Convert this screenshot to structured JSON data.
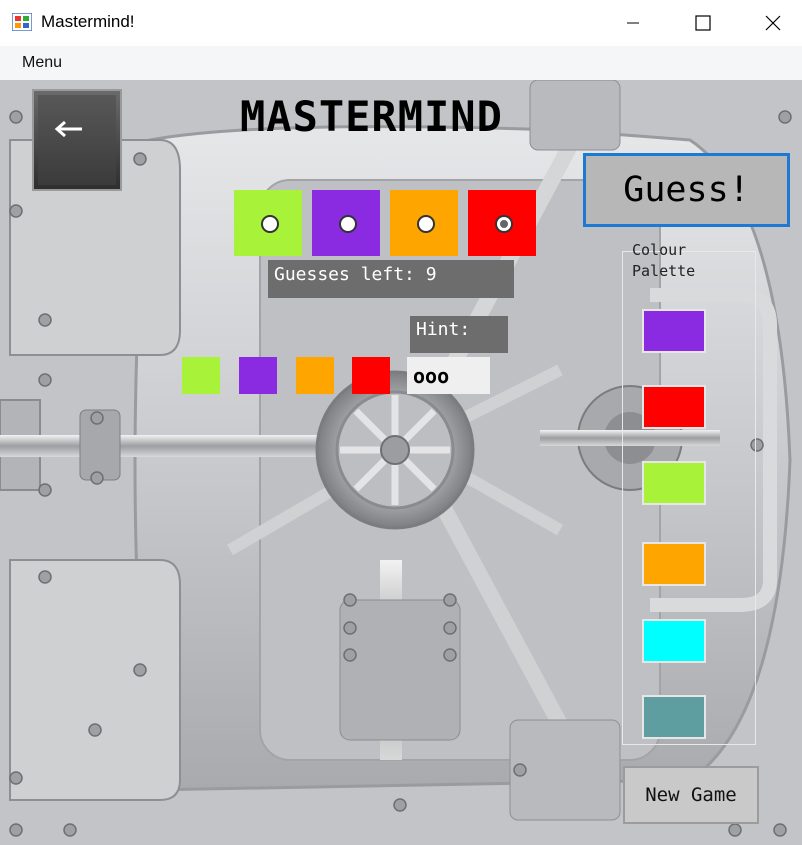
{
  "window": {
    "title": "Mastermind!"
  },
  "menu": {
    "items": [
      "Menu"
    ]
  },
  "game": {
    "title": "MASTERMIND",
    "guess_button": "Guess!",
    "current_guess": [
      {
        "color": "#a8f23a",
        "selected": false
      },
      {
        "color": "#8a2be2",
        "selected": false
      },
      {
        "color": "#ffa500",
        "selected": false
      },
      {
        "color": "#ff0000",
        "selected": true
      }
    ],
    "guesses_left": "Guesses left: 9",
    "hint_label": "Hint:",
    "hint_value": "ooo",
    "previous_guess": [
      "#a8f23a",
      "#8a2be2",
      "#ffa500",
      "#ff0000"
    ],
    "palette_title": "Colour Palette",
    "palette": [
      "#8a2be2",
      "#ff0000",
      "#a8f23a",
      "#ffa500",
      "#00ffff",
      "#5f9ea0"
    ],
    "new_game_button": "New Game"
  }
}
